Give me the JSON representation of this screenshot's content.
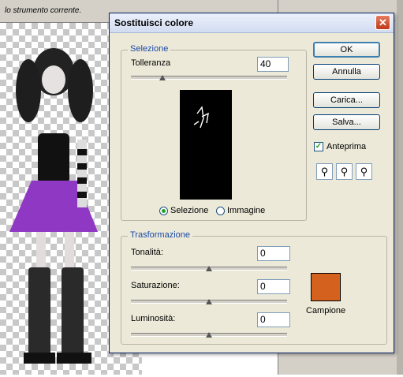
{
  "background": {
    "hint_text": "lo strumento corrente."
  },
  "dialog": {
    "title": "Sostituisci colore",
    "selezione": {
      "legend": "Selezione",
      "tolleranza_label": "Tolleranza",
      "tolleranza_value": "40",
      "tolleranza_level": 0.2,
      "radio_selezione": "Selezione",
      "radio_immagine": "Immagine",
      "selected_mode": "Selezione"
    },
    "buttons": {
      "ok": "OK",
      "annulla": "Annulla",
      "carica": "Carica...",
      "salva": "Salva..."
    },
    "anteprima_label": "Anteprima",
    "anteprima_checked": true,
    "eyedroppers": [
      "eyedropper-icon",
      "eyedropper-plus-icon",
      "eyedropper-minus-icon"
    ],
    "trasformazione": {
      "legend": "Trasformazione",
      "tonalita_label": "Tonalità:",
      "tonalita_value": "0",
      "saturazione_label": "Saturazione:",
      "saturazione_value": "0",
      "luminosita_label": "Luminosità:",
      "luminosita_value": "0",
      "slider_level": 0.5
    },
    "campione_label": "Campione",
    "campione_color": "#d4621e",
    "accent_color": "#1a4aa8"
  }
}
